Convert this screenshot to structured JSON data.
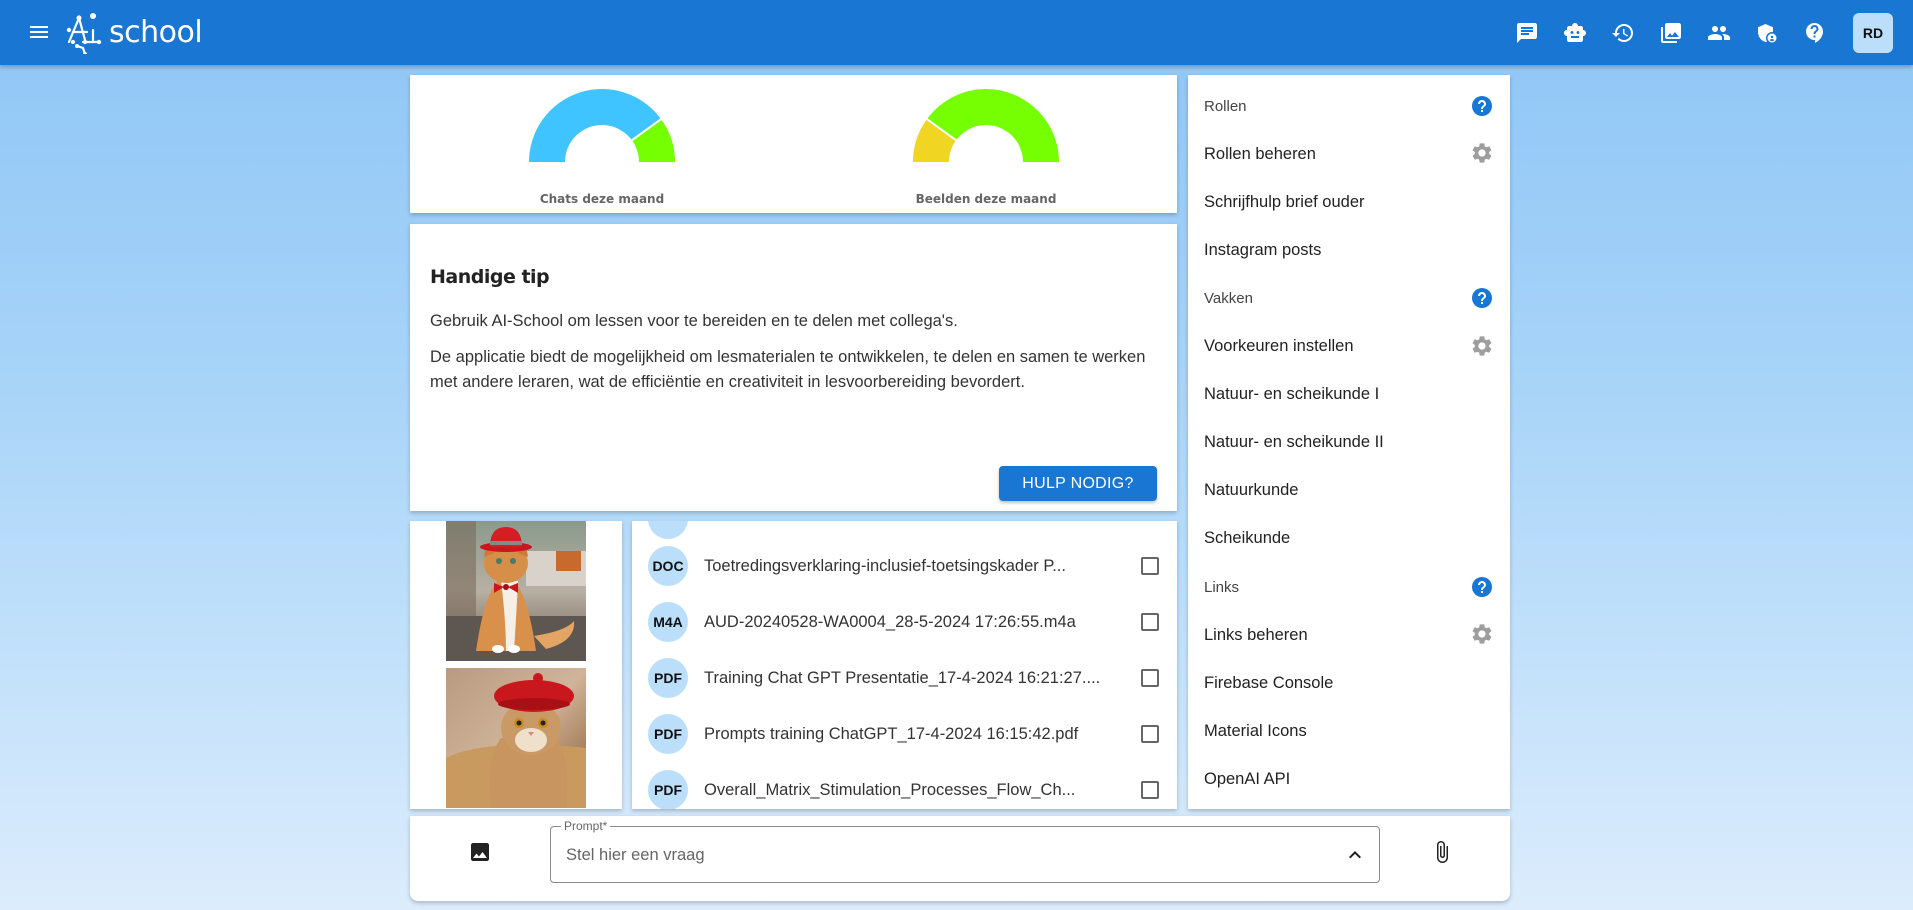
{
  "app": {
    "logo_text": "school",
    "logo_prefix": "Ai"
  },
  "header": {
    "icons": [
      {
        "name": "chat-icon",
        "label": "Chats"
      },
      {
        "name": "robot-icon",
        "label": "Assistants"
      },
      {
        "name": "history-icon",
        "label": "History"
      },
      {
        "name": "photo-library-icon",
        "label": "Images"
      },
      {
        "name": "people-icon",
        "label": "Users"
      },
      {
        "name": "admin-shield-icon",
        "label": "Admin"
      },
      {
        "name": "help-icon",
        "label": "Help"
      }
    ],
    "avatar_initials": "RD"
  },
  "gauges": [
    {
      "label": "Chats deze maand",
      "used_fraction": 0.8,
      "colors": {
        "used": "#40c4ff",
        "remaining": "#76ff03"
      }
    },
    {
      "label": "Beelden deze maand",
      "used_fraction": 0.2,
      "colors": {
        "used": "#f0d523",
        "remaining": "#76ff03"
      }
    }
  ],
  "tip": {
    "title": "Handige tip",
    "paragraph1": "Gebruik AI-School om lessen voor te bereiden en te delen met collega's.",
    "paragraph2": "De applicatie biedt de mogelijkheid om lesmaterialen te ontwikkelen, te delen en samen te werken met andere leraren, wat de efficiëntie en creativiteit in lesvoorbereiding bevordert.",
    "button_label": "HULP NODIG?"
  },
  "images": [
    {
      "description": "Orange cat wearing red bowler hat and red bow tie"
    },
    {
      "description": "Tabby cat wearing red beret"
    }
  ],
  "files": [
    {
      "type": "DOC",
      "name": "Toetredingsverklaring-inclusief-toetsingskader P...",
      "checked": false
    },
    {
      "type": "M4A",
      "name": "AUD-20240528-WA0004_28-5-2024 17:26:55.m4a",
      "checked": false
    },
    {
      "type": "PDF",
      "name": "Training Chat GPT Presentatie_17-4-2024 16:21:27....",
      "checked": false
    },
    {
      "type": "PDF",
      "name": "Prompts training ChatGPT_17-4-2024 16:15:42.pdf",
      "checked": false
    },
    {
      "type": "PDF",
      "name": "Overall_Matrix_Stimulation_Processes_Flow_Ch...",
      "checked": false
    }
  ],
  "right_panel": {
    "items": [
      {
        "kind": "section",
        "label": "Rollen",
        "icon": "help"
      },
      {
        "kind": "link",
        "label": "Rollen beheren",
        "icon": "settings"
      },
      {
        "kind": "link",
        "label": "Schrijfhulp brief ouder",
        "icon": ""
      },
      {
        "kind": "link",
        "label": "Instagram posts",
        "icon": ""
      },
      {
        "kind": "section",
        "label": "Vakken",
        "icon": "help"
      },
      {
        "kind": "link",
        "label": "Voorkeuren instellen",
        "icon": "settings"
      },
      {
        "kind": "link",
        "label": "Natuur- en scheikunde I",
        "icon": ""
      },
      {
        "kind": "link",
        "label": "Natuur- en scheikunde II",
        "icon": ""
      },
      {
        "kind": "link",
        "label": "Natuurkunde",
        "icon": ""
      },
      {
        "kind": "link",
        "label": "Scheikunde",
        "icon": ""
      },
      {
        "kind": "section",
        "label": "Links",
        "icon": "help"
      },
      {
        "kind": "link",
        "label": "Links beheren",
        "icon": "settings"
      },
      {
        "kind": "link",
        "label": "Firebase Console",
        "icon": ""
      },
      {
        "kind": "link",
        "label": "Material Icons",
        "icon": ""
      },
      {
        "kind": "link",
        "label": "OpenAI API",
        "icon": ""
      }
    ]
  },
  "prompt": {
    "label": "Prompt*",
    "placeholder": "Stel hier een vraag",
    "value": ""
  },
  "colors": {
    "primary": "#1976d2",
    "badge_bg": "#bbdefb",
    "help_icon": "#1976d2",
    "settings_icon": "#9e9e9e"
  }
}
